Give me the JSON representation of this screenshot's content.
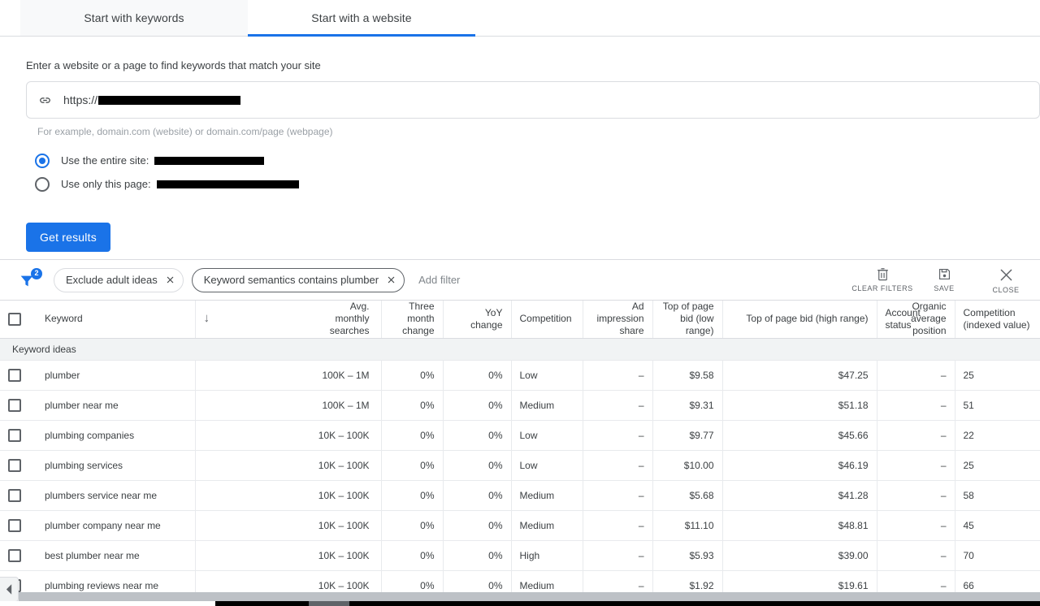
{
  "tabs": [
    {
      "label": "Start with keywords",
      "active": false
    },
    {
      "label": "Start with a website",
      "active": true
    }
  ],
  "form": {
    "label": "Enter a website or a page to find keywords that match your site",
    "url_prefix": "https://",
    "hint": "For example, domain.com (website) or domain.com/page (webpage)",
    "radios": [
      {
        "label": "Use the entire site:",
        "selected": true
      },
      {
        "label": "Use only this page:",
        "selected": false
      }
    ],
    "submit_label": "Get results"
  },
  "filter_bar": {
    "badge_count": "2",
    "chips": [
      {
        "label": "Exclude adult ideas",
        "focused": false
      },
      {
        "label": "Keyword semantics contains plumber",
        "focused": true
      }
    ],
    "add_filter_label": "Add filter",
    "actions": [
      {
        "label": "CLEAR FILTERS",
        "icon": "trash-icon"
      },
      {
        "label": "SAVE",
        "icon": "save-icon"
      },
      {
        "label": "CLOSE",
        "icon": "close-icon"
      }
    ]
  },
  "table": {
    "group_label": "Keyword ideas",
    "columns": [
      "Keyword",
      "Avg. monthly searches",
      "Three month change",
      "YoY change",
      "Competition",
      "Ad impression share",
      "Top of page bid (low range)",
      "Top of page bid (high range)",
      "Account status",
      "Organic average position",
      "Competition (indexed value)"
    ],
    "rows": [
      {
        "keyword": "plumber",
        "avg_monthly_searches": "100K – 1M",
        "three_month_change": "0%",
        "yoy_change": "0%",
        "competition": "Low",
        "ad_impression_share": "–",
        "bid_low": "$9.58",
        "bid_high": "$47.25",
        "account_status": "",
        "organic_avg_position": "–",
        "competition_indexed": "25"
      },
      {
        "keyword": "plumber near me",
        "avg_monthly_searches": "100K – 1M",
        "three_month_change": "0%",
        "yoy_change": "0%",
        "competition": "Medium",
        "ad_impression_share": "–",
        "bid_low": "$9.31",
        "bid_high": "$51.18",
        "account_status": "",
        "organic_avg_position": "–",
        "competition_indexed": "51"
      },
      {
        "keyword": "plumbing companies",
        "avg_monthly_searches": "10K – 100K",
        "three_month_change": "0%",
        "yoy_change": "0%",
        "competition": "Low",
        "ad_impression_share": "–",
        "bid_low": "$9.77",
        "bid_high": "$45.66",
        "account_status": "",
        "organic_avg_position": "–",
        "competition_indexed": "22"
      },
      {
        "keyword": "plumbing services",
        "avg_monthly_searches": "10K – 100K",
        "three_month_change": "0%",
        "yoy_change": "0%",
        "competition": "Low",
        "ad_impression_share": "–",
        "bid_low": "$10.00",
        "bid_high": "$46.19",
        "account_status": "",
        "organic_avg_position": "–",
        "competition_indexed": "25"
      },
      {
        "keyword": "plumbers service near me",
        "avg_monthly_searches": "10K – 100K",
        "three_month_change": "0%",
        "yoy_change": "0%",
        "competition": "Medium",
        "ad_impression_share": "–",
        "bid_low": "$5.68",
        "bid_high": "$41.28",
        "account_status": "",
        "organic_avg_position": "–",
        "competition_indexed": "58"
      },
      {
        "keyword": "plumber company near me",
        "avg_monthly_searches": "10K – 100K",
        "three_month_change": "0%",
        "yoy_change": "0%",
        "competition": "Medium",
        "ad_impression_share": "–",
        "bid_low": "$11.10",
        "bid_high": "$48.81",
        "account_status": "",
        "organic_avg_position": "–",
        "competition_indexed": "45"
      },
      {
        "keyword": "best plumber near me",
        "avg_monthly_searches": "10K – 100K",
        "three_month_change": "0%",
        "yoy_change": "0%",
        "competition": "High",
        "ad_impression_share": "–",
        "bid_low": "$5.93",
        "bid_high": "$39.00",
        "account_status": "",
        "organic_avg_position": "–",
        "competition_indexed": "70"
      },
      {
        "keyword": "plumbing reviews near me",
        "avg_monthly_searches": "10K – 100K",
        "three_month_change": "0%",
        "yoy_change": "0%",
        "competition": "Medium",
        "ad_impression_share": "–",
        "bid_low": "$1.92",
        "bid_high": "$19.61",
        "account_status": "",
        "organic_avg_position": "–",
        "competition_indexed": "66"
      }
    ]
  },
  "colors": {
    "accent": "#1a73e8",
    "text": "#3c4043",
    "muted": "#80868b",
    "border": "#dadce0",
    "group_bg": "#f1f3f4"
  }
}
